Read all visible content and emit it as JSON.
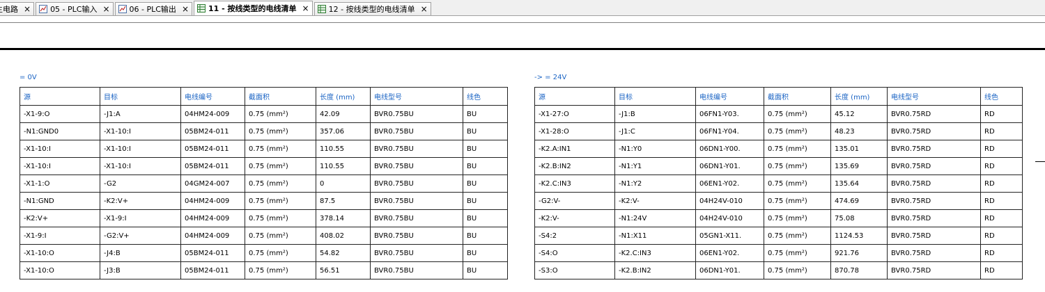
{
  "tabs": [
    {
      "label": "主电路",
      "icon": "close-icon",
      "active": false
    },
    {
      "label": "05 - PLC输入",
      "icon": "chart-page-icon",
      "active": false
    },
    {
      "label": "06 - PLC输出",
      "icon": "chart-page-icon",
      "active": false
    },
    {
      "label": "11 - 按线类型的电线清单",
      "icon": "table-page-icon",
      "active": true
    },
    {
      "label": "12 - 按线类型的电线清单",
      "icon": "table-page-icon",
      "active": false
    }
  ],
  "close_glyph": "×",
  "left_table": {
    "caption": "= 0V",
    "headers": [
      "源",
      "目标",
      "电线编号",
      "截面积",
      "长度 (mm)",
      "电线型号",
      "线色"
    ],
    "rows": [
      [
        "-X1-9:O",
        "-J1:A",
        "04HM24-009",
        "0.75 (mm²)",
        "42.09",
        "BVR0.75BU",
        "BU"
      ],
      [
        "-N1:GND0",
        "-X1-10:I",
        "05BM24-011",
        "0.75 (mm²)",
        "357.06",
        "BVR0.75BU",
        "BU"
      ],
      [
        "-X1-10:I",
        "-X1-10:I",
        "05BM24-011",
        "0.75 (mm²)",
        "110.55",
        "BVR0.75BU",
        "BU"
      ],
      [
        "-X1-10:I",
        "-X1-10:I",
        "05BM24-011",
        "0.75 (mm²)",
        "110.55",
        "BVR0.75BU",
        "BU"
      ],
      [
        "-X1-1:O",
        "-G2",
        "04GM24-007",
        "0.75 (mm²)",
        "0",
        "BVR0.75BU",
        "BU"
      ],
      [
        "-N1:GND",
        "-K2:V+",
        "04HM24-009",
        "0.75 (mm²)",
        "87.5",
        "BVR0.75BU",
        "BU"
      ],
      [
        "-K2:V+",
        "-X1-9:I",
        "04HM24-009",
        "0.75 (mm²)",
        "378.14",
        "BVR0.75BU",
        "BU"
      ],
      [
        "-X1-9:I",
        "-G2:V+",
        "04HM24-009",
        "0.75 (mm²)",
        "408.02",
        "BVR0.75BU",
        "BU"
      ],
      [
        "-X1-10:O",
        "-J4:B",
        "05BM24-011",
        "0.75 (mm²)",
        "54.82",
        "BVR0.75BU",
        "BU"
      ],
      [
        "-X1-10:O",
        "-J3:B",
        "05BM24-011",
        "0.75 (mm²)",
        "56.51",
        "BVR0.75BU",
        "BU"
      ]
    ]
  },
  "right_table": {
    "caption": "-> = 24V",
    "headers": [
      "源",
      "目标",
      "电线编号",
      "截面积",
      "长度 (mm)",
      "电线型号",
      "线色"
    ],
    "rows": [
      [
        "-X1-27:O",
        "-J1:B",
        "06FN1-Y03.",
        "0.75 (mm²)",
        "45.12",
        "BVR0.75RD",
        "RD"
      ],
      [
        "-X1-28:O",
        "-J1:C",
        "06FN1-Y04.",
        "0.75 (mm²)",
        "48.23",
        "BVR0.75RD",
        "RD"
      ],
      [
        "-K2.A:IN1",
        "-N1:Y0",
        "06DN1-Y00.",
        "0.75 (mm²)",
        "135.01",
        "BVR0.75RD",
        "RD"
      ],
      [
        "-K2.B:IN2",
        "-N1:Y1",
        "06DN1-Y01.",
        "0.75 (mm²)",
        "135.69",
        "BVR0.75RD",
        "RD"
      ],
      [
        "-K2.C:IN3",
        "-N1:Y2",
        "06EN1-Y02.",
        "0.75 (mm²)",
        "135.64",
        "BVR0.75RD",
        "RD"
      ],
      [
        "-G2:V-",
        "-K2:V-",
        "04H24V-010",
        "0.75 (mm²)",
        "474.69",
        "BVR0.75RD",
        "RD"
      ],
      [
        "-K2:V-",
        "-N1:24V",
        "04H24V-010",
        "0.75 (mm²)",
        "75.08",
        "BVR0.75RD",
        "RD"
      ],
      [
        "-S4:2",
        "-N1:X11",
        "05GN1-X11.",
        "0.75 (mm²)",
        "1124.53",
        "BVR0.75RD",
        "RD"
      ],
      [
        "-S4:O",
        "-K2.C:IN3",
        "06EN1-Y02.",
        "0.75 (mm²)",
        "921.76",
        "BVR0.75RD",
        "RD"
      ],
      [
        "-S3:O",
        "-K2.B:IN2",
        "06DN1-Y01.",
        "0.75 (mm²)",
        "870.78",
        "BVR0.75RD",
        "RD"
      ]
    ]
  },
  "colors": {
    "header_text": "#1b64c4",
    "border": "#222222",
    "tab_bg": "#f0f0f0"
  }
}
